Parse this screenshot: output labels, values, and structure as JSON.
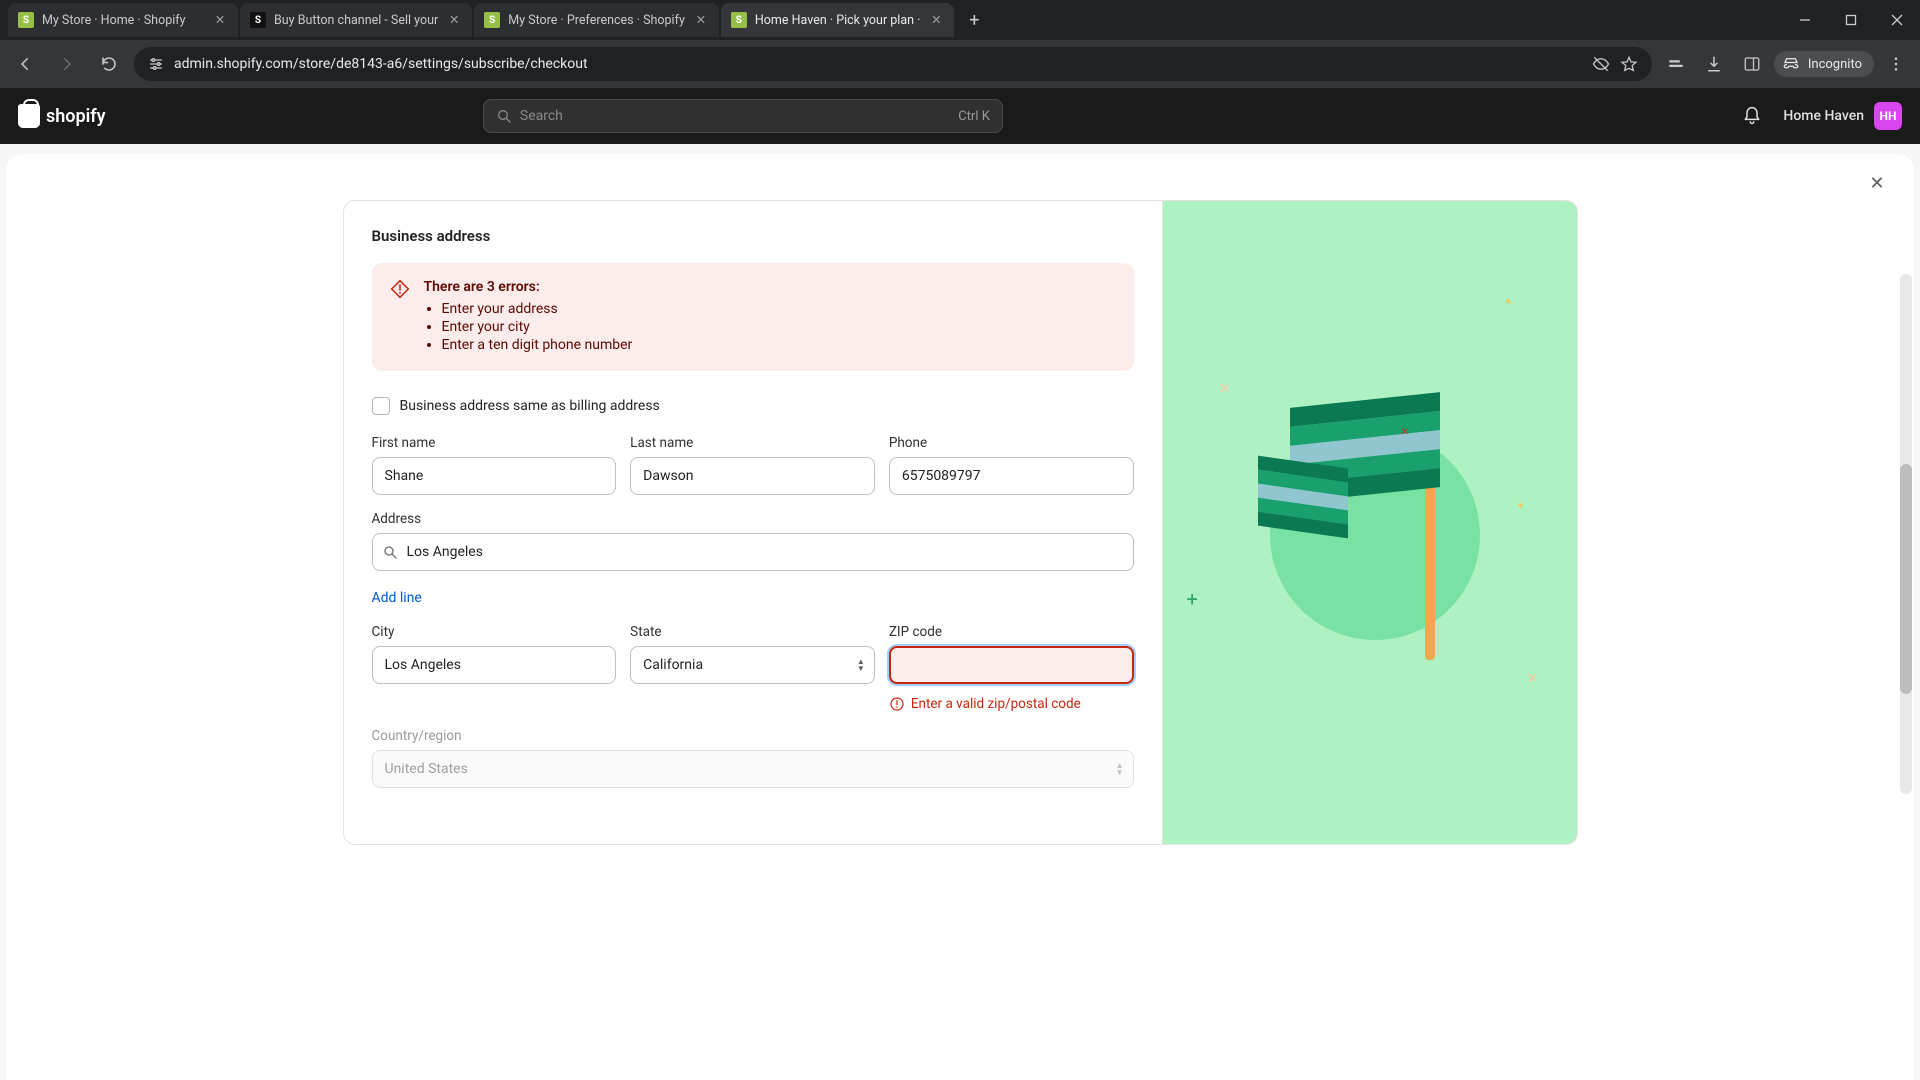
{
  "browser": {
    "tabs": [
      {
        "title": "My Store · Home · Shopify",
        "fav": "green"
      },
      {
        "title": "Buy Button channel - Sell your",
        "fav": "dark"
      },
      {
        "title": "My Store · Preferences · Shopify",
        "fav": "green"
      },
      {
        "title": "Home Haven · Pick your plan ·",
        "fav": "green"
      }
    ],
    "url": "admin.shopify.com/store/de8143-a6/settings/subscribe/checkout",
    "incognito": "Incognito"
  },
  "shopify": {
    "brand": "shopify",
    "search_placeholder": "Search",
    "kbd": "Ctrl K",
    "store_name": "Home Haven",
    "avatar_initials": "HH"
  },
  "form": {
    "section_title": "Business address",
    "alert": {
      "title": "There are 3 errors:",
      "items": [
        "Enter your address",
        "Enter your city",
        "Enter a ten digit phone number"
      ]
    },
    "same_as_billing_label": "Business address same as billing address",
    "labels": {
      "first_name": "First name",
      "last_name": "Last name",
      "phone": "Phone",
      "address": "Address",
      "add_line": "Add line",
      "city": "City",
      "state": "State",
      "zip": "ZIP code",
      "country": "Country/region"
    },
    "values": {
      "first_name": "Shane",
      "last_name": "Dawson",
      "phone": "6575089797",
      "address": "Los Angeles",
      "city": "Los Angeles",
      "state": "California",
      "zip": "",
      "country": "United States"
    },
    "zip_error": "Enter a valid zip/postal code"
  }
}
